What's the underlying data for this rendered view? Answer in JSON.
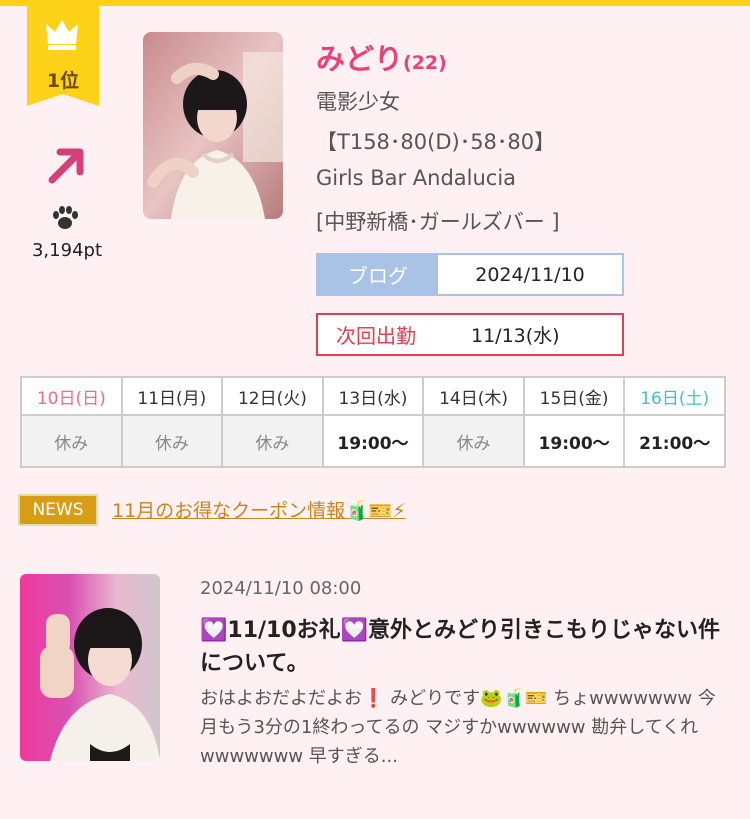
{
  "rank": {
    "label": "1位",
    "trend": "up",
    "points": "3,194pt"
  },
  "profile": {
    "name": "みどり",
    "age": "(22)",
    "type": "電影少女",
    "measurements": "【T158･80(D)･58･80】",
    "shop": "Girls Bar Andalucia",
    "area": "[中野新橋･ガールズバー ]"
  },
  "blog": {
    "label": "ブログ",
    "date": "2024/11/10"
  },
  "next_shift": {
    "label": "次回出勤",
    "date": "11/13(水)"
  },
  "schedule": {
    "days": [
      "10日(日)",
      "11日(月)",
      "12日(火)",
      "13日(水)",
      "14日(木)",
      "15日(金)",
      "16日(土)"
    ],
    "slots": [
      "休み",
      "休み",
      "休み",
      "19:00〜",
      "休み",
      "19:00〜",
      "21:00〜"
    ]
  },
  "news": {
    "badge": "NEWS",
    "link_text": "11月のお得なクーポン情報🧃🎫⚡"
  },
  "post": {
    "date": "2024/11/10 08:00",
    "title": "💟11/10お礼💟意外とみどり引きこもりじゃない件について。",
    "excerpt": "おはよおだよだよお❗️ みどりです🐸🧃🎫 ちょwwwwwww 今月もう3分の1終わってるの マジすかwwwwww 勘弁してくれwwwwwww 早すぎる..."
  },
  "colors": {
    "accent_pink": "#e8427a",
    "gold": "#ffd21a",
    "blog_blue": "#a9c3e6",
    "next_red": "#e0404f",
    "news_gold": "#d89d16"
  },
  "icons": [
    "crown-icon",
    "trend-up-arrow-icon",
    "paw-icon"
  ]
}
